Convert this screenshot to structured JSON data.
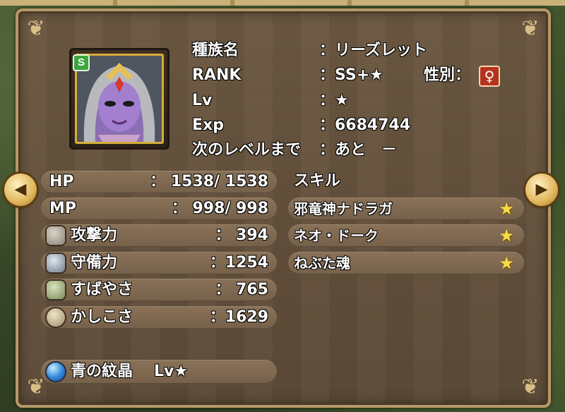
{
  "info": {
    "rows": [
      {
        "label": "種族名",
        "value": "：リーズレット"
      },
      {
        "label": "RANK",
        "value": "：SS+★"
      },
      {
        "label": "Lv",
        "value": "：★"
      },
      {
        "label": "Exp",
        "value": "：6684744"
      },
      {
        "label": "次のレベルまで",
        "value": "：あと　－"
      }
    ],
    "gender_label": "性別：",
    "gender_symbol": "♀",
    "rank_badge": "S"
  },
  "stats": {
    "hp": {
      "label": "HP",
      "value": "：  1538/ 1538"
    },
    "mp": {
      "label": "MP",
      "value": "：   998/   998"
    },
    "attack": {
      "label": "攻撃力",
      "value": "：    394"
    },
    "defense": {
      "label": "守備力",
      "value": "：1254"
    },
    "agility": {
      "label": "すばやさ",
      "value": "：    765"
    },
    "wisdom": {
      "label": "かしこさ",
      "value": "：1629"
    }
  },
  "skills": {
    "header": "スキル",
    "items": [
      {
        "name": "邪竜神ナドラガ",
        "star": "★"
      },
      {
        "name": "ネオ・ドーク",
        "star": "★"
      },
      {
        "name": "ねぶた魂",
        "star": "★"
      }
    ]
  },
  "crest": {
    "name": "青の紋晶",
    "level": "Lv★"
  },
  "nav": {
    "prev": "◀",
    "next": "▶"
  },
  "icons": {
    "attack": "sword-icon",
    "defense": "shield-icon",
    "agility": "boot-icon",
    "wisdom": "ring-icon",
    "crest": "blue-gem-icon"
  }
}
